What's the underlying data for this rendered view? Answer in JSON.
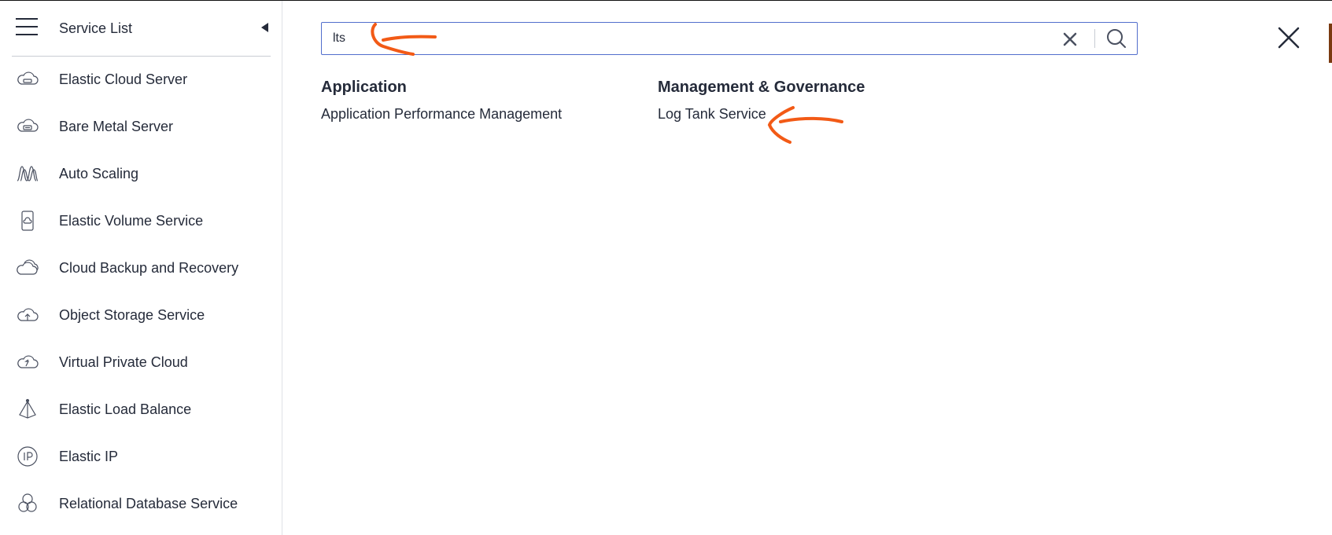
{
  "sidebar": {
    "title": "Service List",
    "items": [
      {
        "label": "Elastic Cloud Server",
        "icon": "cloud-server-icon"
      },
      {
        "label": "Bare Metal Server",
        "icon": "bare-metal-icon"
      },
      {
        "label": "Auto Scaling",
        "icon": "auto-scaling-icon"
      },
      {
        "label": "Elastic Volume Service",
        "icon": "volume-icon"
      },
      {
        "label": "Cloud Backup and Recovery",
        "icon": "backup-cloud-icon"
      },
      {
        "label": "Object Storage Service",
        "icon": "upload-cloud-icon"
      },
      {
        "label": "Virtual Private Cloud",
        "icon": "vpc-cloud-icon"
      },
      {
        "label": "Elastic Load Balance",
        "icon": "load-balance-icon"
      },
      {
        "label": "Elastic IP",
        "icon": "ip-icon"
      },
      {
        "label": "Relational Database Service",
        "icon": "database-icon"
      }
    ]
  },
  "search": {
    "value": "lts",
    "placeholder": ""
  },
  "results": [
    {
      "group": "Application",
      "items": [
        "Application Performance Management"
      ]
    },
    {
      "group": "Management & Governance",
      "items": [
        "Log Tank Service"
      ]
    }
  ],
  "colors": {
    "accent": "#526ecc",
    "annotation": "#f25a16",
    "text": "#252b3a"
  }
}
